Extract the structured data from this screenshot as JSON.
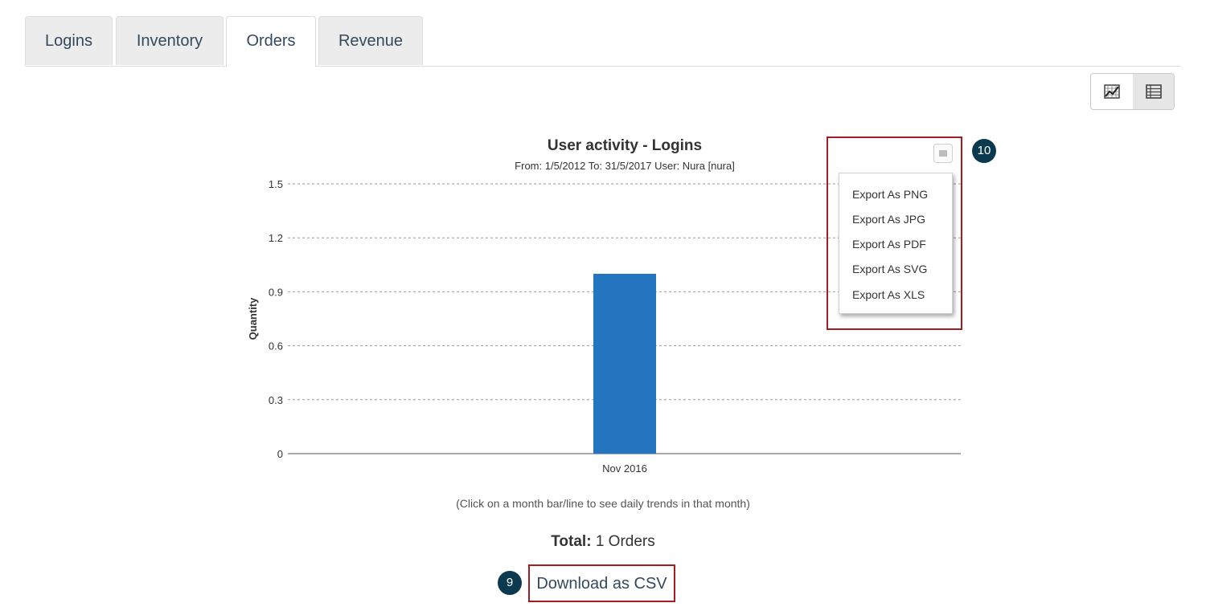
{
  "tabs": [
    {
      "label": "Logins",
      "active": false
    },
    {
      "label": "Inventory",
      "active": false
    },
    {
      "label": "Orders",
      "active": true
    },
    {
      "label": "Revenue",
      "active": false
    }
  ],
  "view_toggle": {
    "chart_icon": "chart-icon",
    "table_icon": "table-icon",
    "selected": "chart"
  },
  "chart": {
    "title": "User activity - Logins",
    "subtitle": "From: 1/5/2012 To: 31/5/2017 User: Nura [nura]",
    "hint": "(Click on a month bar/line to see daily trends in that month)"
  },
  "chart_data": {
    "type": "bar",
    "title": "User activity - Logins",
    "subtitle": "From: 1/5/2012 To: 31/5/2017 User: Nura [nura]",
    "categories": [
      "Nov 2016"
    ],
    "values": [
      1
    ],
    "xlabel": "",
    "ylabel": "Quantity",
    "ylim": [
      0,
      1.5
    ],
    "yticks": [
      "0",
      "0.3",
      "0.6",
      "0.9",
      "1.2",
      "1.5"
    ],
    "grid": true,
    "bar_color": "#2475c0"
  },
  "export_menu": {
    "button_icon": "menu-icon",
    "items": [
      "Export As PNG",
      "Export As JPG",
      "Export As PDF",
      "Export As SVG",
      "Export As XLS"
    ]
  },
  "total": {
    "label": "Total:",
    "value": "1 Orders"
  },
  "download": {
    "label": "Download as CSV"
  },
  "callouts": {
    "download": "9",
    "export": "10"
  },
  "colors": {
    "callout_border": "#a31d21",
    "badge_bg": "#0b3a4f",
    "link": "#34495e"
  }
}
